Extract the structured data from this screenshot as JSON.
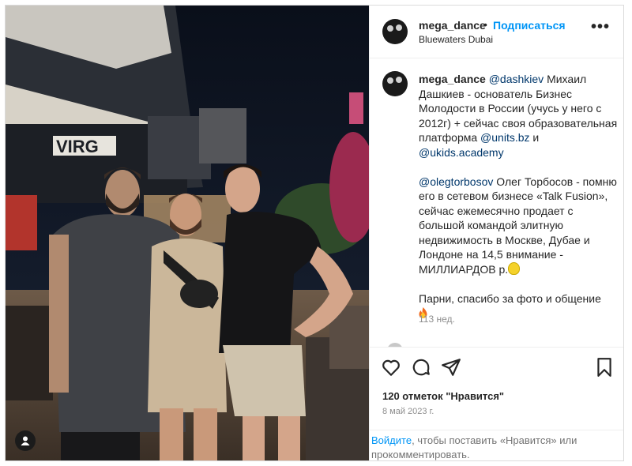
{
  "post": {
    "username": "mega_dance",
    "follow_label": "Подписаться",
    "separator": "•",
    "location": "Bluewaters Dubai",
    "more_label": "•••",
    "photo_alt_sign": "VIRG"
  },
  "caption": {
    "username": "mega_dance",
    "mention_1": "@dashkiev",
    "text_1": " Михаил Дашкиев - основатель Бизнес Молодости в России (учусь у него с 2012г) + сейчас своя образовательная платформа ",
    "link_1": "@units.bz",
    "and_word": " и ",
    "link_2": "@ukids.academy",
    "mention_2": "@olegtorbosov",
    "text_2": " Олег Торбосов - помню его в сетевом бизнесе «Talk Fusion», сейчас ежемесячно продает с большой командой элитную недвижимость в Москве, Дубае и Лондоне на 14,5 внимание - МИЛЛИАРДОВ р.",
    "text_3": "Парни, спасибо за фото и общение",
    "time_ago": "113 нед."
  },
  "actions": {
    "likes": "120 отметок \"Нравится\"",
    "date": "8 май 2023 г.",
    "login_link": "Войдите",
    "login_text": ", чтобы поставить «Нравится» или прокомментировать."
  },
  "icons": [
    "heart-icon",
    "comment-icon",
    "share-icon",
    "bookmark-icon",
    "user-tag-icon",
    "more-icon"
  ],
  "colors": {
    "accent": "#0095f6",
    "link": "#00376b",
    "muted": "#8e8e8e",
    "text": "#262626"
  }
}
